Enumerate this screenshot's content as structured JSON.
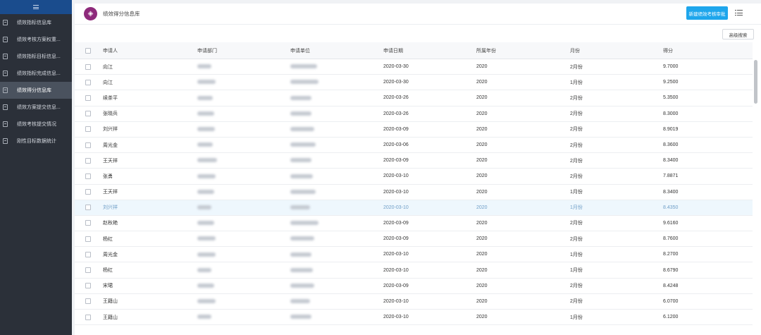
{
  "sidebar": {
    "items": [
      {
        "label": "绩效指标信息库",
        "active": false
      },
      {
        "label": "绩效考核方案权重...",
        "active": false
      },
      {
        "label": "绩效指标目标信息...",
        "active": false
      },
      {
        "label": "绩效指标完成信息...",
        "active": false
      },
      {
        "label": "绩效得分信息库",
        "active": true
      },
      {
        "label": "绩效方案提交信息...",
        "active": false
      },
      {
        "label": "绩效考核提交情况",
        "active": false
      },
      {
        "label": "刚性目标数据统计",
        "active": false
      }
    ]
  },
  "header": {
    "title": "绩效得分信息库",
    "new_button": "新建绩效考核审批",
    "advanced_search": "高级搜索"
  },
  "colors": {
    "accent": "#1ea6ec",
    "sidebar_bg": "#2b3039",
    "sidebar_top": "#1a4c8d",
    "logo": "#8e2a7b"
  },
  "table": {
    "columns": [
      "申请人",
      "申请部门",
      "申请单位",
      "申请日期",
      "所属年份",
      "月份",
      "得分"
    ],
    "rows": [
      {
        "name": "向江",
        "date": "2020-03-30",
        "year": "2020",
        "month": "2月份",
        "score": "9.7000"
      },
      {
        "name": "向江",
        "date": "2020-03-30",
        "year": "2020",
        "month": "1月份",
        "score": "9.2500"
      },
      {
        "name": "续茶平",
        "date": "2020-03-26",
        "year": "2020",
        "month": "2月份",
        "score": "5.3500"
      },
      {
        "name": "张晓兵",
        "date": "2020-03-26",
        "year": "2020",
        "month": "2月份",
        "score": "8.3000"
      },
      {
        "name": "刘兴祥",
        "date": "2020-03-09",
        "year": "2020",
        "month": "2月份",
        "score": "8.9019"
      },
      {
        "name": "周光金",
        "date": "2020-03-06",
        "year": "2020",
        "month": "2月份",
        "score": "8.3600"
      },
      {
        "name": "王天祥",
        "date": "2020-03-09",
        "year": "2020",
        "month": "2月份",
        "score": "8.3400"
      },
      {
        "name": "张勇",
        "date": "2020-03-10",
        "year": "2020",
        "month": "2月份",
        "score": "7.8871"
      },
      {
        "name": "王天祥",
        "date": "2020-03-10",
        "year": "2020",
        "month": "1月份",
        "score": "8.3400"
      },
      {
        "name": "刘兴祥",
        "date": "2020-03-10",
        "year": "2020",
        "month": "1月份",
        "score": "8.4350"
      },
      {
        "name": "赵秋艳",
        "date": "2020-03-09",
        "year": "2020",
        "month": "2月份",
        "score": "9.6160"
      },
      {
        "name": "杨红",
        "date": "2020-03-09",
        "year": "2020",
        "month": "2月份",
        "score": "8.7600"
      },
      {
        "name": "周光金",
        "date": "2020-03-10",
        "year": "2020",
        "month": "1月份",
        "score": "8.2700"
      },
      {
        "name": "杨红",
        "date": "2020-03-10",
        "year": "2020",
        "month": "1月份",
        "score": "8.6790"
      },
      {
        "name": "宋珺",
        "date": "2020-03-09",
        "year": "2020",
        "month": "2月份",
        "score": "8.4248"
      },
      {
        "name": "王籍山",
        "date": "2020-03-10",
        "year": "2020",
        "month": "2月份",
        "score": "6.0700"
      },
      {
        "name": "王籍山",
        "date": "2020-03-10",
        "year": "2020",
        "month": "1月份",
        "score": "6.1200"
      }
    ]
  }
}
